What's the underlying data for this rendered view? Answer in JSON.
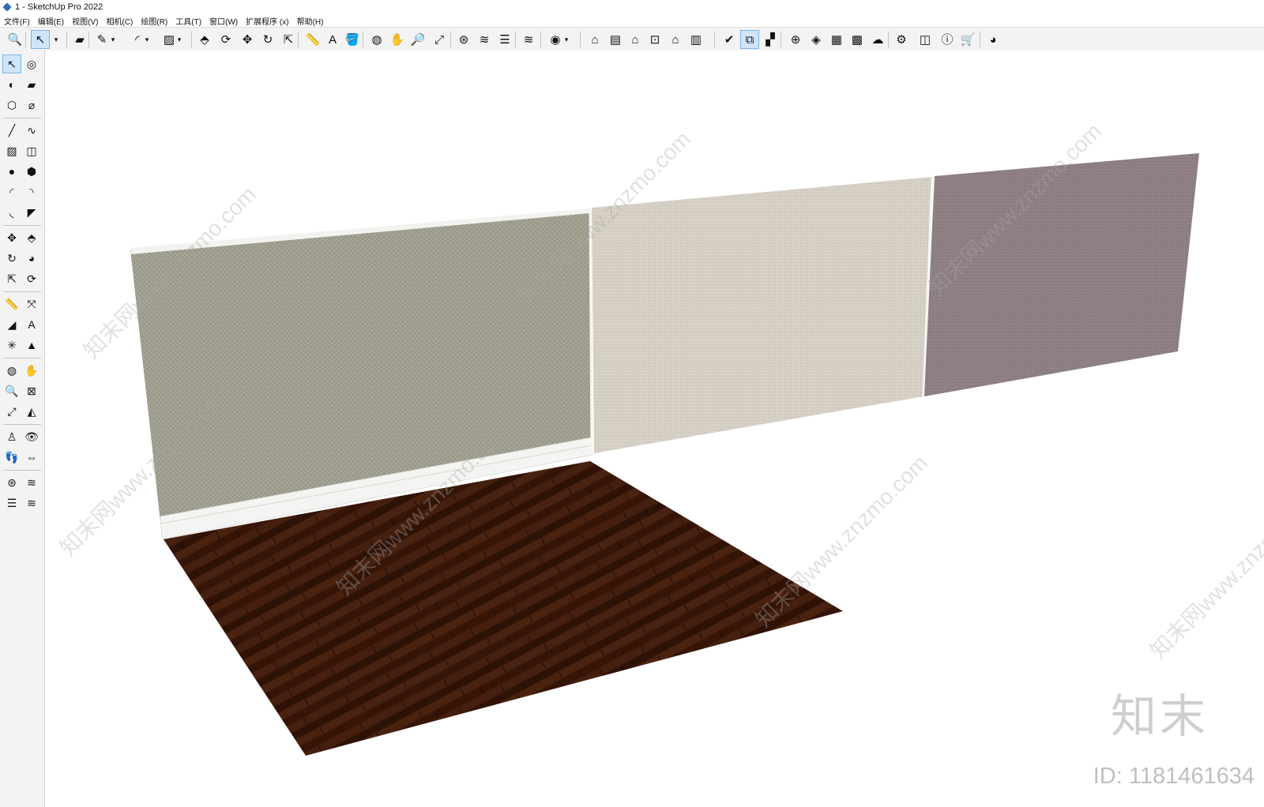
{
  "window": {
    "title": "1 - SketchUp Pro 2022"
  },
  "menu": [
    "文件(F)",
    "编辑(E)",
    "视图(V)",
    "相机(C)",
    "绘图(R)",
    "工具(T)",
    "窗口(W)",
    "扩展程序 (x)",
    "帮助(H)"
  ],
  "toolbar_icons": [
    {
      "name": "zoom-icon",
      "glyph": "🔍"
    },
    {
      "name": "select-icon",
      "glyph": "↖",
      "selected": true
    },
    {
      "name": "select-dropdown-icon",
      "glyph": "▾"
    },
    {
      "name": "eraser-icon",
      "glyph": "▰"
    },
    {
      "name": "pencil-icon",
      "glyph": "✎"
    },
    {
      "name": "pencil-dropdown-icon",
      "glyph": "▾"
    },
    {
      "name": "arc-icon",
      "glyph": "◜"
    },
    {
      "name": "arc-dropdown-icon",
      "glyph": "▾"
    },
    {
      "name": "rectangle-icon",
      "glyph": "▨"
    },
    {
      "name": "rectangle-dropdown-icon",
      "glyph": "▾"
    },
    {
      "name": "push-pull-icon",
      "glyph": "⬘"
    },
    {
      "name": "offset-icon",
      "glyph": "⟳"
    },
    {
      "name": "move-icon",
      "glyph": "✥"
    },
    {
      "name": "rotate-icon",
      "glyph": "↻"
    },
    {
      "name": "scale-icon",
      "glyph": "⇱"
    },
    {
      "name": "tape-measure-icon",
      "glyph": "📏"
    },
    {
      "name": "text-icon",
      "glyph": "A"
    },
    {
      "name": "paint-bucket-icon",
      "glyph": "🪣"
    },
    {
      "name": "orbit-icon",
      "glyph": "◍"
    },
    {
      "name": "pan-icon",
      "glyph": "✋"
    },
    {
      "name": "zoom-tool-icon",
      "glyph": "🔎"
    },
    {
      "name": "zoom-extents-icon",
      "glyph": "⤢"
    },
    {
      "name": "warehouse-icon",
      "glyph": "⊛"
    },
    {
      "name": "section-icon",
      "glyph": "≋"
    },
    {
      "name": "layers-icon",
      "glyph": "☰"
    },
    {
      "name": "tags-icon",
      "glyph": "≋"
    },
    {
      "name": "profile-icon",
      "glyph": "◉"
    },
    {
      "name": "profile-dropdown-icon",
      "glyph": "▾"
    },
    {
      "name": "iso-view-icon",
      "glyph": "⌂"
    },
    {
      "name": "front-view-icon",
      "glyph": "▤"
    },
    {
      "name": "home-view-icon",
      "glyph": "⌂"
    },
    {
      "name": "top-view-icon",
      "glyph": "⊡"
    },
    {
      "name": "right-view-icon",
      "glyph": "⌂"
    },
    {
      "name": "back-view-icon",
      "glyph": "▥"
    },
    {
      "name": "styles-icon",
      "glyph": "✔"
    },
    {
      "name": "outliner-icon",
      "glyph": "⧉",
      "selected": true
    },
    {
      "name": "scenes-icon",
      "glyph": "▞"
    },
    {
      "name": "add-location-icon",
      "glyph": "⊕"
    },
    {
      "name": "shadows-icon",
      "glyph": "◈"
    },
    {
      "name": "fog-icon",
      "glyph": "▦"
    },
    {
      "name": "materials-icon",
      "glyph": "▩"
    },
    {
      "name": "cloud-icon",
      "glyph": "☁"
    },
    {
      "name": "extension-manager-icon",
      "glyph": "⚙"
    },
    {
      "name": "messages-icon",
      "glyph": "◫"
    },
    {
      "name": "info-icon",
      "glyph": "ⓘ"
    },
    {
      "name": "cart-icon",
      "glyph": "🛒"
    },
    {
      "name": "account-icon",
      "glyph": "◕"
    }
  ],
  "left_tools": [
    {
      "name": "select-tool-icon",
      "glyph": "↖",
      "selected": true
    },
    {
      "name": "orbit-tool-icon",
      "glyph": "◎"
    },
    {
      "name": "paint-tool-icon",
      "glyph": "◐"
    },
    {
      "name": "eraser-tool-icon",
      "glyph": "▰"
    },
    {
      "name": "component-tool-icon",
      "glyph": "⬡"
    },
    {
      "name": "eyedropper-tool-icon",
      "glyph": "⌀"
    },
    {
      "name": "line-tool-icon",
      "glyph": "╱"
    },
    {
      "name": "freehand-tool-icon",
      "glyph": "∿"
    },
    {
      "name": "rectangle-tool-icon",
      "glyph": "▨"
    },
    {
      "name": "rotated-rectangle-tool-icon",
      "glyph": "◫"
    },
    {
      "name": "circle-tool-icon",
      "glyph": "●"
    },
    {
      "name": "polygon-tool-icon",
      "glyph": "⬢"
    },
    {
      "name": "arc-tool-icon",
      "glyph": "◜"
    },
    {
      "name": "two-point-arc-tool-icon",
      "glyph": "◝"
    },
    {
      "name": "three-point-arc-tool-icon",
      "glyph": "◟"
    },
    {
      "name": "pie-tool-icon",
      "glyph": "◤"
    },
    {
      "name": "move-tool-icon",
      "glyph": "✥"
    },
    {
      "name": "push-pull-tool-icon",
      "glyph": "⬘"
    },
    {
      "name": "rotate-tool-icon",
      "glyph": "↻"
    },
    {
      "name": "follow-me-tool-icon",
      "glyph": "◕"
    },
    {
      "name": "scale-tool-icon",
      "glyph": "⇱"
    },
    {
      "name": "offset-tool-icon",
      "glyph": "⟳"
    },
    {
      "name": "tape-tool-icon",
      "glyph": "📏"
    },
    {
      "name": "dimension-tool-icon",
      "glyph": "⤧"
    },
    {
      "name": "protractor-tool-icon",
      "glyph": "◢"
    },
    {
      "name": "text-tool-icon",
      "glyph": "A"
    },
    {
      "name": "axes-tool-icon",
      "glyph": "✳"
    },
    {
      "name": "3d-text-tool-icon",
      "glyph": "▲"
    },
    {
      "name": "orbit-nav-icon",
      "glyph": "◍"
    },
    {
      "name": "pan-nav-icon",
      "glyph": "✋"
    },
    {
      "name": "zoom-nav-icon",
      "glyph": "🔍"
    },
    {
      "name": "zoom-window-icon",
      "glyph": "⊠"
    },
    {
      "name": "zoom-extents-nav-icon",
      "glyph": "⤢"
    },
    {
      "name": "previous-view-icon",
      "glyph": "◭"
    },
    {
      "name": "position-camera-icon",
      "glyph": "♙"
    },
    {
      "name": "look-around-icon",
      "glyph": "👁"
    },
    {
      "name": "walk-icon",
      "glyph": "👣"
    },
    {
      "name": "section-plane-icon",
      "glyph": "⇔"
    },
    {
      "name": "warehouse-left-icon",
      "glyph": "⊛"
    },
    {
      "name": "section-display-icon",
      "glyph": "≋"
    },
    {
      "name": "layers-left-icon",
      "glyph": "☰"
    },
    {
      "name": "section-fill-icon",
      "glyph": "≋"
    }
  ],
  "watermark_text": "知末网www.znzmo.com",
  "logo": {
    "brand": "知末",
    "id_text": "ID: 1181461634"
  },
  "colors": {
    "toolbar_bg": "#f3f3f3",
    "selected_bg": "#cfe5fb",
    "wall_gray": "#a4a394",
    "wall_beige": "#d4cec3",
    "wall_mauve": "#8d7e82",
    "floor_wood": "#3d1a0b",
    "baseboard": "#f5f5f3"
  }
}
